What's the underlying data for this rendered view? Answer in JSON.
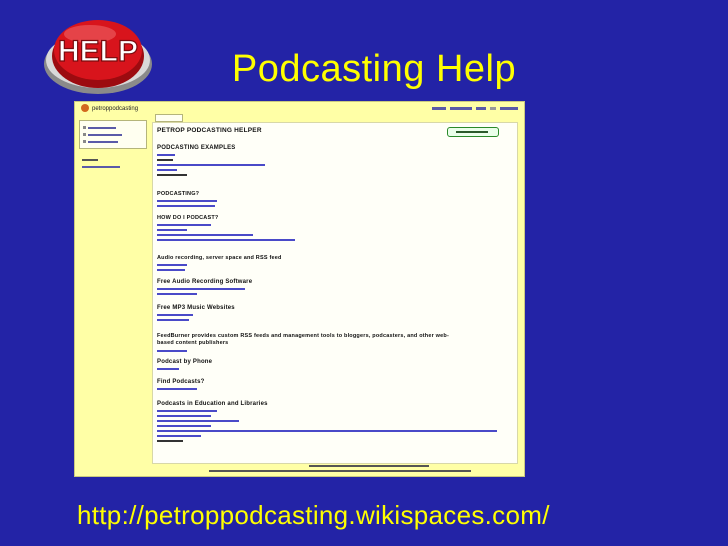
{
  "slide": {
    "badge_text": "HELP",
    "title": "Podcasting Help",
    "url": "http://petroppodcasting.wikispaces.com/"
  },
  "screenshot": {
    "site_name": "petroppodcasting",
    "page_heading": "PETROP PODCASTING HELPER",
    "sections": [
      "PODCASTING EXAMPLES",
      "PODCASTING?",
      "HOW DO I PODCAST?",
      "Audio recording, server space and RSS feed",
      "Free Audio Recording Software",
      "Free MP3 Music Websites",
      "FeedBurner provides custom RSS feeds and management tools to bloggers, podcasters, and other web-based content publishers",
      "Podcast by Phone",
      "Find Podcasts?",
      "Podcasts in Education and Libraries"
    ]
  },
  "colors": {
    "slide_background": "#2323a6",
    "title_yellow": "#ffff00",
    "help_red": "#d8141c"
  }
}
